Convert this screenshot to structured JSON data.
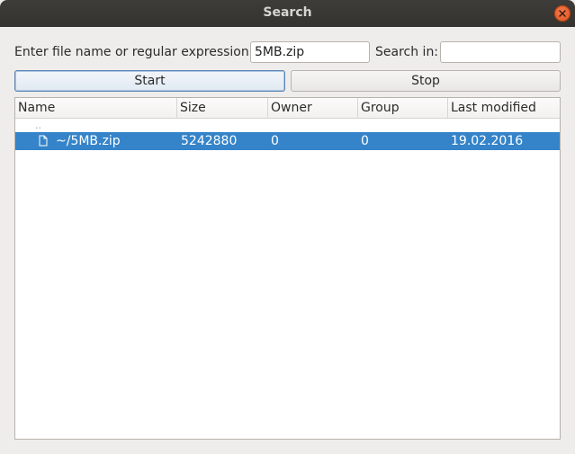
{
  "window": {
    "title": "Search"
  },
  "form": {
    "filename_label": "Enter file name or regular expression:",
    "filename_value": "5MB.zip",
    "search_in_label": "Search in:",
    "search_in_value": ""
  },
  "buttons": {
    "start_label": "Start",
    "stop_label": "Stop"
  },
  "results": {
    "columns": [
      "Name",
      "Size",
      "Owner",
      "Group",
      "Last modified"
    ],
    "parent_entry": "..",
    "rows": [
      {
        "name": "~/5MB.zip",
        "size": "5242880",
        "owner": "0",
        "group": "0",
        "last_modified": "19.02.2016",
        "icon": "file-icon",
        "selected": true
      }
    ]
  },
  "colors": {
    "titlebar": "#3a3935",
    "selection": "#3584c9",
    "close_button": "#e95420"
  }
}
